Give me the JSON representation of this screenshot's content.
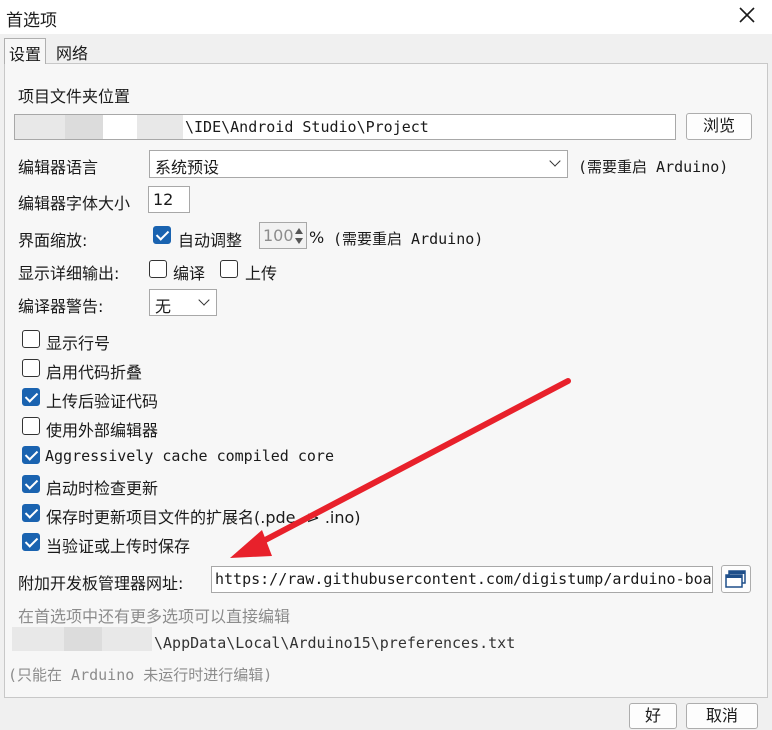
{
  "window": {
    "title": "首选项",
    "tabs": [
      "设置",
      "网络"
    ]
  },
  "settings": {
    "sketchbook_label": "项目文件夹位置",
    "sketchbook_path": "\\IDE\\Android Studio\\Project",
    "browse_label": "浏览",
    "language_label": "编辑器语言",
    "language_value": "系统预设",
    "restart_note": "(需要重启 Arduino)",
    "font_size_label": "编辑器字体大小",
    "font_size_value": "12",
    "scale_label": "界面缩放:",
    "auto_scale_label": "自动调整",
    "scale_value": "100",
    "scale_unit": "%",
    "scale_restart_note": "(需要重启 Arduino)",
    "verbose_label": "显示详细输出:",
    "verbose_compile_label": "编译",
    "verbose_upload_label": "上传",
    "warnings_label": "编译器警告:",
    "warnings_value": "无",
    "checkboxes": [
      {
        "label": "显示行号",
        "checked": false
      },
      {
        "label": "启用代码折叠",
        "checked": false
      },
      {
        "label": "上传后验证代码",
        "checked": true
      },
      {
        "label": "使用外部编辑器",
        "checked": false
      },
      {
        "label": "Aggressively cache compiled core",
        "checked": true
      },
      {
        "label": "启动时检查更新",
        "checked": true
      },
      {
        "label": "保存时更新项目文件的扩展名(.pde -> .ino)",
        "checked": true
      },
      {
        "label": "当验证或上传时保存",
        "checked": true
      }
    ],
    "board_urls_label": "附加开发板管理器网址:",
    "board_urls_value": "https://raw.githubusercontent.com/digistump/arduino-boa",
    "more_prefs_note": "在首选项中还有更多选项可以直接编辑",
    "prefs_path": "\\AppData\\Local\\Arduino15\\preferences.txt",
    "edit_note": "(只能在 Arduino 未运行时进行编辑)"
  },
  "footer": {
    "ok_label": "好",
    "cancel_label": "取消"
  },
  "colors": {
    "accent": "#1a63b0",
    "annotation_arrow": "#e8212b"
  }
}
